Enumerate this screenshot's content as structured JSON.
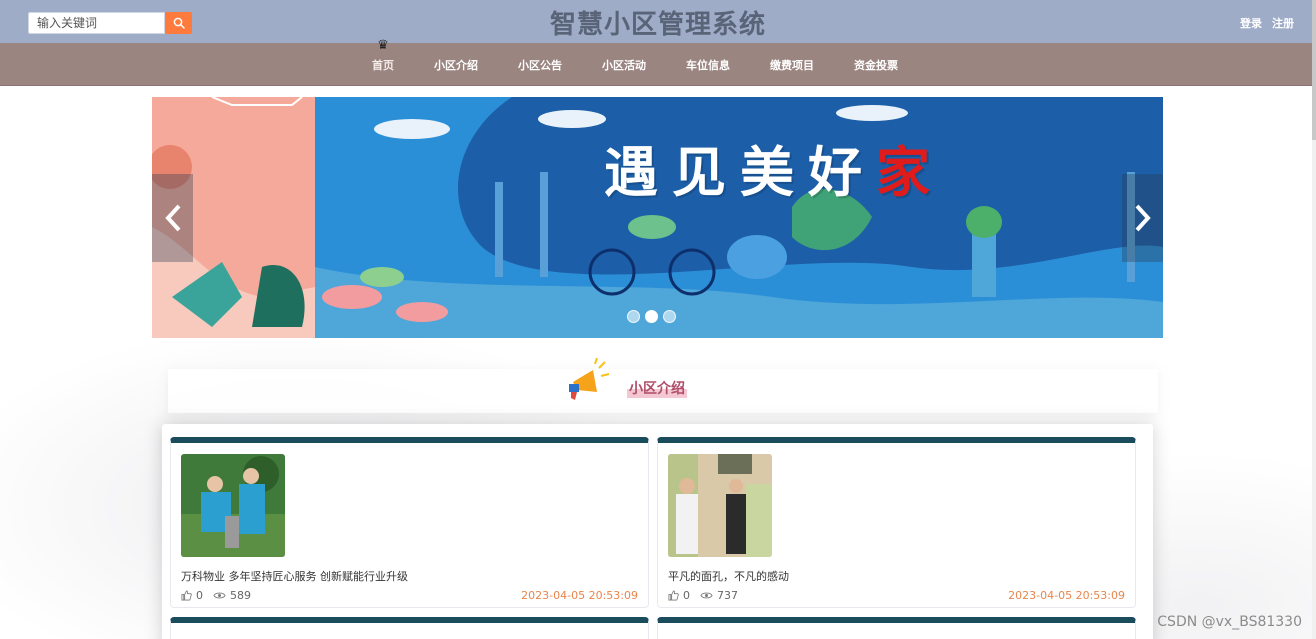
{
  "header": {
    "site_title": "智慧小区管理系统",
    "search_placeholder": "输入关键词",
    "login": "登录",
    "register": "注册"
  },
  "nav": {
    "items": [
      {
        "label": "首页",
        "active": true
      },
      {
        "label": "小区介绍"
      },
      {
        "label": "小区公告"
      },
      {
        "label": "小区活动"
      },
      {
        "label": "车位信息"
      },
      {
        "label": "缴费项目"
      },
      {
        "label": "资金投票"
      }
    ]
  },
  "banner": {
    "text_main": "遇见美好",
    "text_accent": "家",
    "slides_total": 3,
    "active_slide": 2
  },
  "section": {
    "title": "小区介绍"
  },
  "cards": [
    {
      "title": "万科物业 多年坚持匠心服务 创新赋能行业升级",
      "likes": "0",
      "views": "589",
      "date": "2023-04-05 20:53:09"
    },
    {
      "title": "平凡的面孔，不凡的感动",
      "likes": "0",
      "views": "737",
      "date": "2023-04-05 20:53:09"
    }
  ],
  "watermark": "CSDN @vx_BS81330",
  "colors": {
    "topbar": "#9eacc8",
    "navbar": "#9b8581",
    "search_button": "#ff7a3d",
    "card_border_top": "#1b4c5c",
    "date": "#e8854c"
  }
}
